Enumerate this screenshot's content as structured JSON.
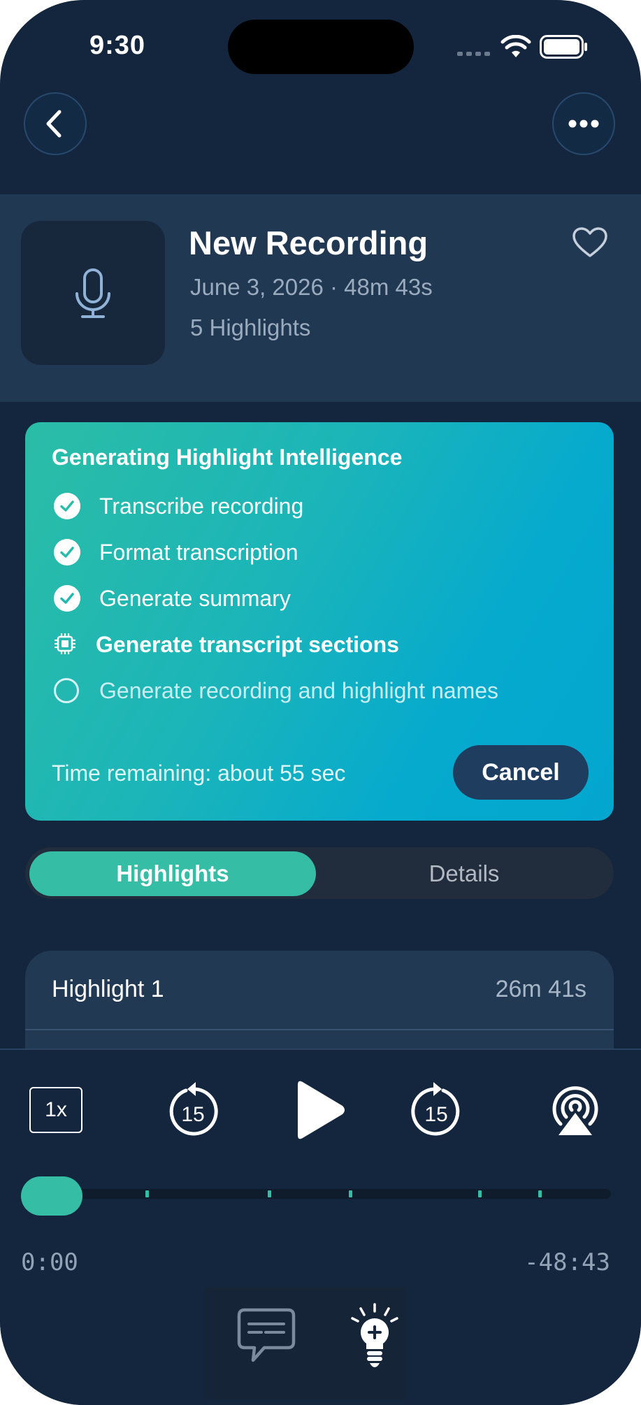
{
  "status_bar": {
    "time": "9:30"
  },
  "recording": {
    "title": "New Recording",
    "meta": "June 3, 2026 · 48m 43s",
    "highlights_count": "5 Highlights"
  },
  "intelligence": {
    "title": "Generating Highlight Intelligence",
    "steps": [
      {
        "label": "Transcribe recording",
        "state": "done"
      },
      {
        "label": "Format transcription",
        "state": "done"
      },
      {
        "label": "Generate summary",
        "state": "done"
      },
      {
        "label": "Generate transcript sections",
        "state": "in-progress"
      },
      {
        "label": "Generate recording and highlight names",
        "state": "pending"
      }
    ],
    "time_remaining": "Time remaining: about 55 sec",
    "cancel_label": "Cancel"
  },
  "tabs": {
    "highlights": "Highlights",
    "details": "Details",
    "selected": "Highlights"
  },
  "highlight_list": [
    {
      "title": "Highlight 1",
      "duration": "26m 41s"
    }
  ],
  "player": {
    "speed": "1x",
    "skip_back": "15",
    "skip_forward": "15",
    "current_time": "0:00",
    "remaining_time": "-48:43",
    "progress": 0,
    "highlight_marks_count": 5
  },
  "colors": {
    "background": "#14263d",
    "accent": "#35bda6",
    "card_gradient_start": "#2bbda6",
    "card_gradient_end": "#03a6cf"
  }
}
